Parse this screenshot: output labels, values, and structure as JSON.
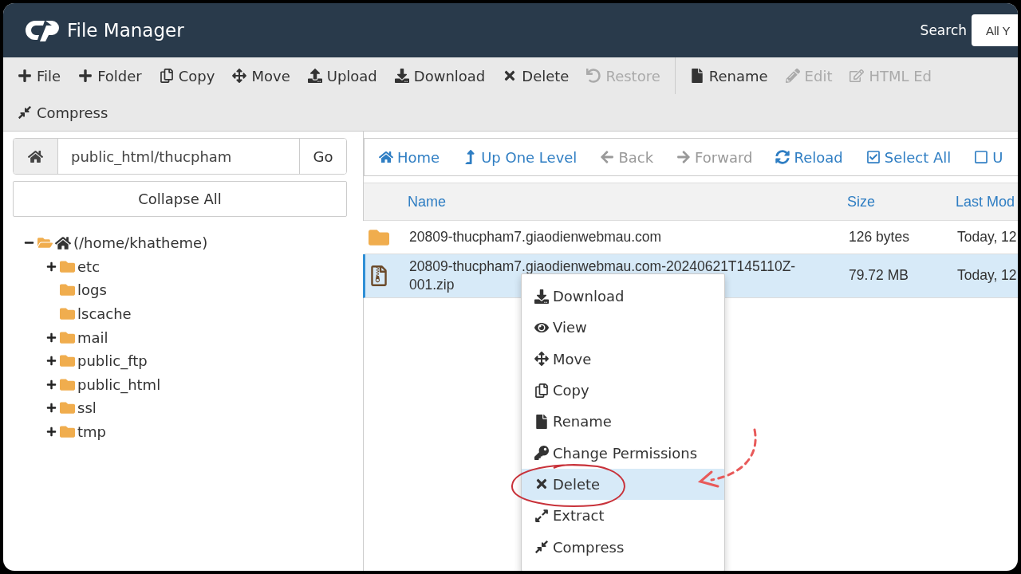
{
  "header": {
    "title": "File Manager",
    "search_label": "Search",
    "search_scope": "All Y"
  },
  "toolbar": [
    {
      "kind": "new-file",
      "label": "File",
      "disabled": false
    },
    {
      "kind": "new-folder",
      "label": "Folder",
      "disabled": false
    },
    {
      "kind": "copy",
      "label": "Copy",
      "disabled": false
    },
    {
      "kind": "move",
      "label": "Move",
      "disabled": false
    },
    {
      "kind": "upload",
      "label": "Upload",
      "disabled": false
    },
    {
      "kind": "download",
      "label": "Download",
      "disabled": false
    },
    {
      "kind": "delete",
      "label": "Delete",
      "disabled": false
    },
    {
      "kind": "restore",
      "label": "Restore",
      "disabled": true
    },
    {
      "kind": "rename",
      "label": "Rename",
      "disabled": false
    },
    {
      "kind": "edit",
      "label": "Edit",
      "disabled": true
    },
    {
      "kind": "html-edit",
      "label": "HTML Ed",
      "disabled": true
    },
    {
      "kind": "compress",
      "label": "Compress",
      "disabled": false
    }
  ],
  "path_bar": {
    "value": "public_html/thucpham",
    "go": "Go"
  },
  "collapse_all": "Collapse All",
  "tree": [
    {
      "label": "(/home/khatheme)",
      "home": true,
      "expanded": true,
      "children": [
        {
          "label": "etc",
          "expandable": true,
          "expanded": false
        },
        {
          "label": "logs",
          "expandable": false
        },
        {
          "label": "lscache",
          "expandable": false
        },
        {
          "label": "mail",
          "expandable": true,
          "expanded": false
        },
        {
          "label": "public_ftp",
          "expandable": true,
          "expanded": false
        },
        {
          "label": "public_html",
          "expandable": true,
          "expanded": false
        },
        {
          "label": "ssl",
          "expandable": true,
          "expanded": false
        },
        {
          "label": "tmp",
          "expandable": true,
          "expanded": false
        }
      ]
    }
  ],
  "nav": [
    {
      "kind": "home",
      "label": "Home",
      "disabled": false
    },
    {
      "kind": "up",
      "label": "Up One Level",
      "disabled": false
    },
    {
      "kind": "back",
      "label": "Back",
      "disabled": true
    },
    {
      "kind": "forward",
      "label": "Forward",
      "disabled": true
    },
    {
      "kind": "reload",
      "label": "Reload",
      "disabled": false
    },
    {
      "kind": "select-all",
      "label": "Select All",
      "disabled": false
    },
    {
      "kind": "unselect",
      "label": "U",
      "disabled": false
    }
  ],
  "table": {
    "columns": [
      "Name",
      "Size",
      "Last Mod"
    ],
    "rows": [
      {
        "kind": "folder",
        "name": "20809-thucpham7.giaodienwebmau.com",
        "size": "126 bytes",
        "modified": "Today, 12",
        "selected": false
      },
      {
        "kind": "archive",
        "name": "20809-thucpham7.giaodienwebmau.com-20240621T145110Z-001.zip",
        "size": "79.72 MB",
        "modified": "Today, 12",
        "selected": true
      }
    ]
  },
  "context_menu": [
    {
      "kind": "download",
      "label": "Download",
      "selected": false
    },
    {
      "kind": "view",
      "label": "View",
      "selected": false
    },
    {
      "kind": "move",
      "label": "Move",
      "selected": false
    },
    {
      "kind": "copy",
      "label": "Copy",
      "selected": false
    },
    {
      "kind": "rename",
      "label": "Rename",
      "selected": false
    },
    {
      "kind": "permissions",
      "label": "Change Permissions",
      "selected": false
    },
    {
      "kind": "delete",
      "label": "Delete",
      "selected": true
    },
    {
      "kind": "extract",
      "label": "Extract",
      "selected": false
    },
    {
      "kind": "compress",
      "label": "Compress",
      "selected": false
    }
  ]
}
